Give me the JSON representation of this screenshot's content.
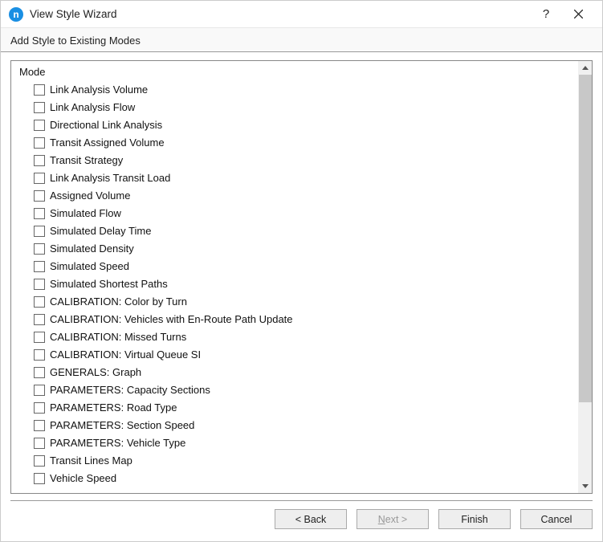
{
  "titlebar": {
    "icon_letter": "n",
    "title": "View Style Wizard",
    "help": "?"
  },
  "subheader": "Add Style to Existing Modes",
  "column_header": "Mode",
  "items": [
    "Link Analysis Volume",
    "Link Analysis Flow",
    "Directional Link Analysis",
    "Transit Assigned Volume",
    "Transit Strategy",
    "Link Analysis Transit Load",
    "Assigned Volume",
    "Simulated Flow",
    "Simulated Delay Time",
    "Simulated Density",
    "Simulated Speed",
    "Simulated Shortest Paths",
    "CALIBRATION: Color by Turn",
    "CALIBRATION: Vehicles with En-Route Path Update",
    "CALIBRATION: Missed Turns",
    "CALIBRATION: Virtual Queue SI",
    "GENERALS: Graph",
    "PARAMETERS: Capacity Sections",
    "PARAMETERS: Road Type",
    "PARAMETERS: Section Speed",
    "PARAMETERS: Vehicle Type",
    "Transit Lines Map",
    "Vehicle Speed"
  ],
  "footer": {
    "back": "< Back",
    "next_prefix": "",
    "next_underlined": "N",
    "next_suffix": "ext >",
    "finish": "Finish",
    "cancel": "Cancel"
  }
}
